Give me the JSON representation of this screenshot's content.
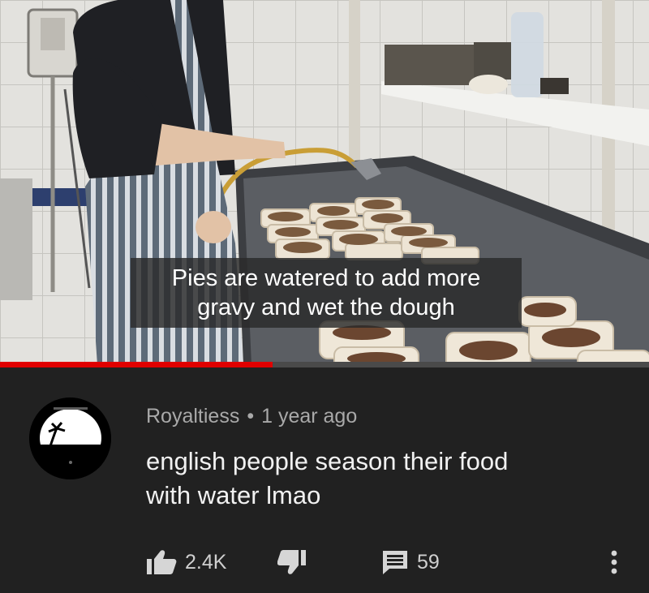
{
  "video": {
    "caption_lines": [
      "Pies are watered to add more",
      "gravy and wet the dough"
    ],
    "progress_fraction": 0.42
  },
  "comment": {
    "author": "Royaltiess",
    "separator": "•",
    "time": "1 year ago",
    "text_lines": [
      "english people season their food",
      "with water lmao"
    ],
    "likes": "2.4K",
    "replies": "59"
  },
  "colors": {
    "background": "#212121",
    "progress": "#e00000",
    "meta_text": "#a9a9a9",
    "comment_text": "#f1f1f1"
  },
  "icons": [
    "thumbs-up-icon",
    "thumbs-down-icon",
    "reply-icon",
    "more-options-icon"
  ]
}
